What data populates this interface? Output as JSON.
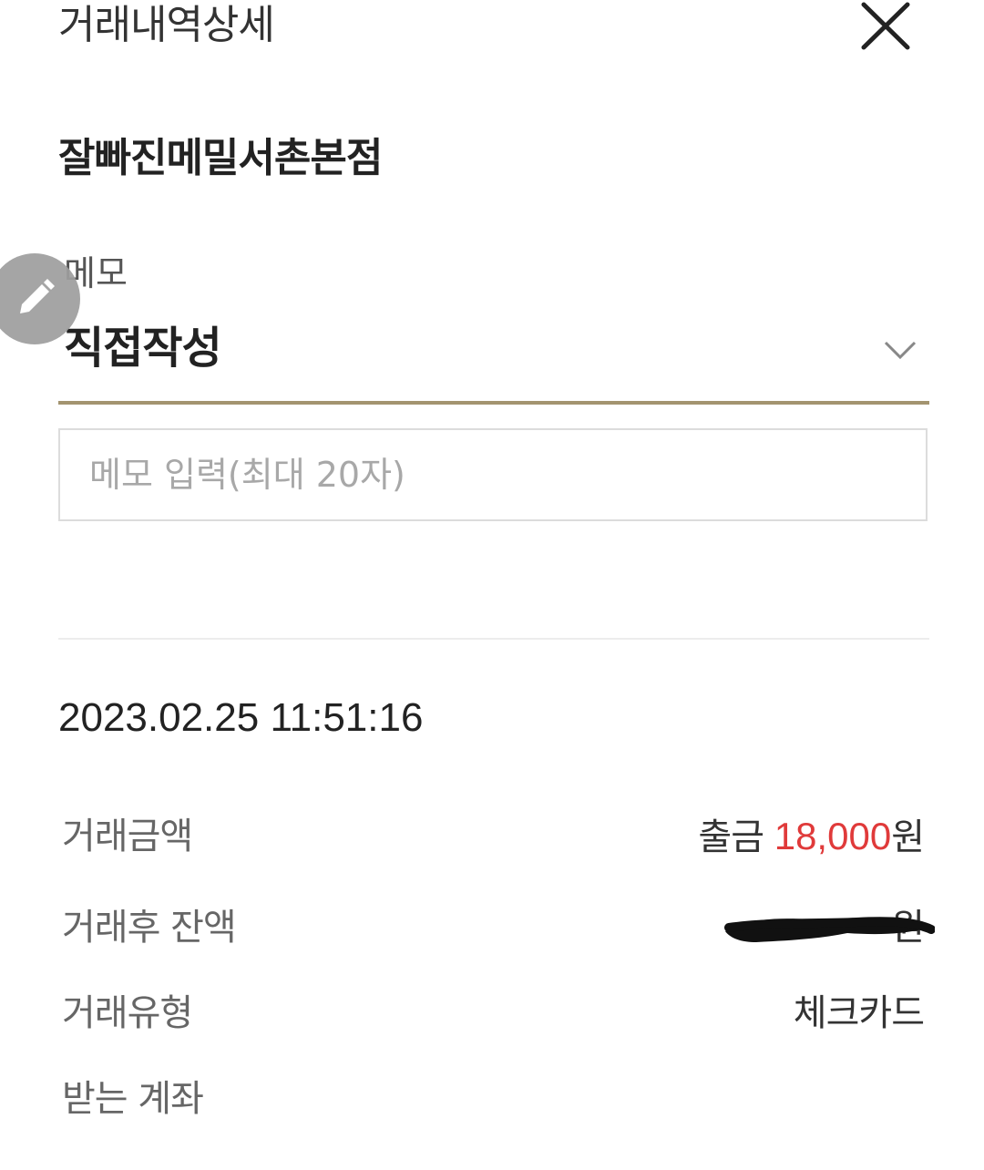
{
  "header": {
    "title": "거래내역상세"
  },
  "merchant": {
    "name": "잘빠진메밀서촌본점"
  },
  "memo": {
    "label": "메모",
    "selected": "직접작성",
    "input_placeholder": "메모 입력(최대 20자)",
    "input_value": ""
  },
  "transaction": {
    "datetime": "2023.02.25 11:51:16",
    "rows": [
      {
        "label": "거래금액",
        "prefix": "출금",
        "amount": "18,000",
        "unit": "원"
      },
      {
        "label": "거래후 잔액",
        "unit": "원"
      },
      {
        "label": "거래유형",
        "value": "체크카드"
      },
      {
        "label": "받는 계좌"
      }
    ]
  },
  "colors": {
    "accent_underline": "#a39470",
    "amount_red": "#e03a3a",
    "fab_gray": "#9e9e9e"
  },
  "icons": {
    "close": "close-icon",
    "dropdown": "chevron-down-icon",
    "edit": "pencil-icon"
  }
}
